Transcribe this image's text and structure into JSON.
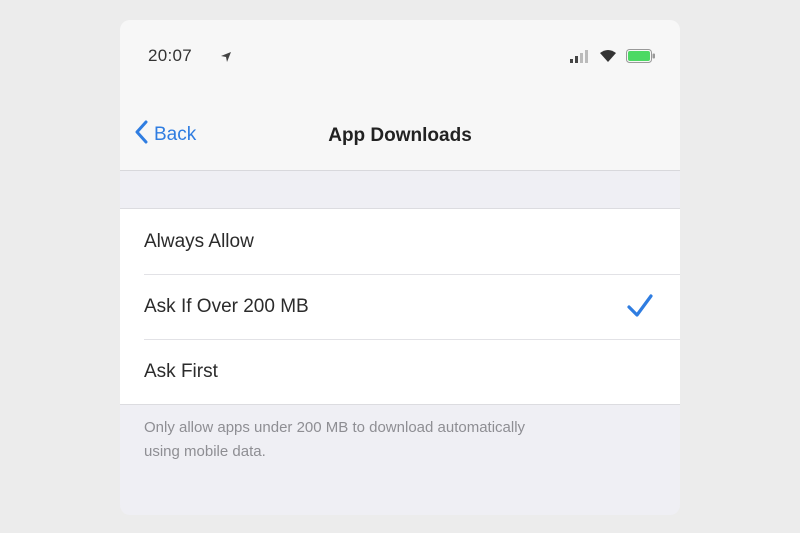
{
  "status_bar": {
    "time": "20:07"
  },
  "nav": {
    "back_label": "Back",
    "title": "App Downloads"
  },
  "options": [
    {
      "label": "Always Allow",
      "selected": false
    },
    {
      "label": "Ask If Over 200 MB",
      "selected": true
    },
    {
      "label": "Ask First",
      "selected": false
    }
  ],
  "footer": {
    "note": "Only allow apps under 200 MB to download automatically using mobile data."
  },
  "colors": {
    "accent": "#2f7de1",
    "battery": "#4cd964"
  },
  "icons": [
    "location-arrow-icon",
    "signal-icon",
    "wifi-icon",
    "battery-icon",
    "chevron-left-icon",
    "checkmark-icon"
  ]
}
